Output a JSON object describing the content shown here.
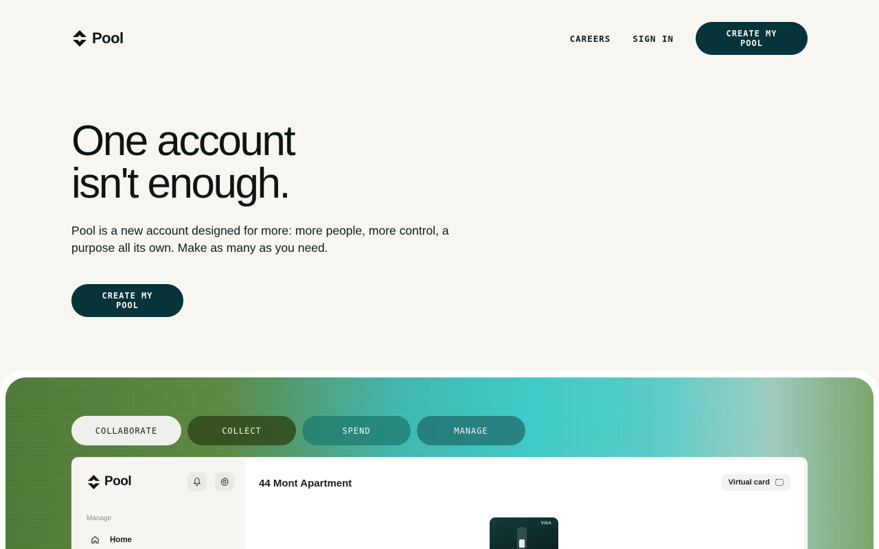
{
  "brand": {
    "name": "Pool"
  },
  "nav": {
    "careers": "CAREERS",
    "sign_in": "SIGN IN",
    "cta": "CREATE MY POOL"
  },
  "hero": {
    "title_line1": "One account",
    "title_line2": "isn't enough.",
    "subtitle": "Pool is a new account designed for more: more people, more control, a purpose all its own. Make as many as you need.",
    "cta": "CREATE MY POOL"
  },
  "tabs": [
    {
      "label": "COLLABORATE",
      "active": true
    },
    {
      "label": "COLLECT",
      "active": false
    },
    {
      "label": "SPEND",
      "active": false
    },
    {
      "label": "MANAGE",
      "active": false
    }
  ],
  "app_preview": {
    "brand": "Pool",
    "sidebar": {
      "section_label": "Manage",
      "items": [
        {
          "label": "Home",
          "icon": "home-icon"
        }
      ]
    },
    "main": {
      "title": "44 Mont Apartment",
      "virtual_card_button": "Virtual card",
      "card_brand": "VISA"
    }
  },
  "colors": {
    "background": "#f8f6f1",
    "primary": "#07333a",
    "text": "#111a18"
  }
}
